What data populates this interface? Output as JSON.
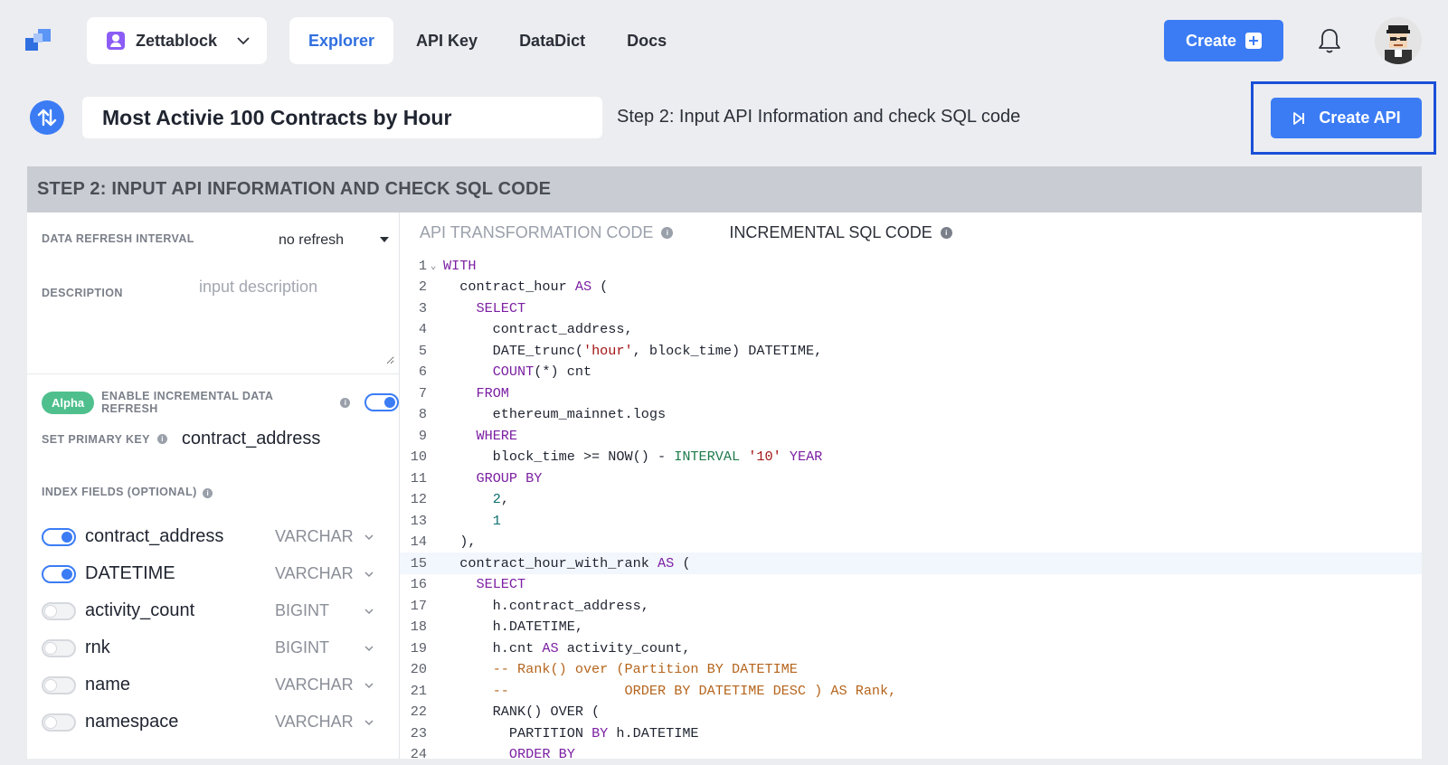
{
  "nav": {
    "workspace": "Zettablock",
    "tabs": [
      "Explorer",
      "API Key",
      "DataDict",
      "Docs"
    ],
    "create_label": "Create"
  },
  "page": {
    "title": "Most Activie 100 Contracts by Hour",
    "step_text": "Step 2: Input API Information and check SQL code",
    "create_api_label": "Create API",
    "panel_header": "STEP 2: INPUT API INFORMATION AND CHECK SQL CODE"
  },
  "form": {
    "refresh_label": "DATA REFRESH INTERVAL",
    "refresh_value": "no refresh",
    "description_label": "DESCRIPTION",
    "description_placeholder": "input description",
    "alpha_badge": "Alpha",
    "incremental_label": "ENABLE INCREMENTAL DATA REFRESH",
    "incremental_enabled": true,
    "primary_key_label": "SET PRIMARY KEY",
    "primary_key_value": "contract_address",
    "index_fields_label": "INDEX FIELDS (OPTIONAL)",
    "fields": [
      {
        "name": "contract_address",
        "type": "VARCHAR",
        "enabled": true
      },
      {
        "name": "DATETIME",
        "type": "VARCHAR",
        "enabled": true
      },
      {
        "name": "activity_count",
        "type": "BIGINT",
        "enabled": false
      },
      {
        "name": "rnk",
        "type": "BIGINT",
        "enabled": false
      },
      {
        "name": "name",
        "type": "VARCHAR",
        "enabled": false
      },
      {
        "name": "namespace",
        "type": "VARCHAR",
        "enabled": false
      }
    ]
  },
  "code": {
    "tabs": [
      "API TRANSFORMATION CODE",
      "INCREMENTAL SQL CODE"
    ],
    "active_tab": 1,
    "highlighted_line": 15,
    "lines": [
      [
        [
          "kw",
          "WITH"
        ]
      ],
      [
        [
          "t",
          "  contract_hour "
        ],
        [
          "kw",
          "AS"
        ],
        [
          "t",
          " ("
        ]
      ],
      [
        [
          "t",
          "    "
        ],
        [
          "kw",
          "SELECT"
        ]
      ],
      [
        [
          "t",
          "      contract_address,"
        ]
      ],
      [
        [
          "t",
          "      DATE_trunc("
        ],
        [
          "str",
          "'hour'"
        ],
        [
          "t",
          ", block_time) DATETIME,"
        ]
      ],
      [
        [
          "t",
          "      "
        ],
        [
          "kw",
          "COUNT"
        ],
        [
          "t",
          "(*) cnt"
        ]
      ],
      [
        [
          "t",
          "    "
        ],
        [
          "kw",
          "FROM"
        ]
      ],
      [
        [
          "t",
          "      ethereum_mainnet.logs"
        ]
      ],
      [
        [
          "t",
          "    "
        ],
        [
          "kw",
          "WHERE"
        ]
      ],
      [
        [
          "t",
          "      block_time >= NOW() - "
        ],
        [
          "intv",
          "INTERVAL"
        ],
        [
          "t",
          " "
        ],
        [
          "str",
          "'10'"
        ],
        [
          "t",
          " "
        ],
        [
          "kw",
          "YEAR"
        ]
      ],
      [
        [
          "t",
          "    "
        ],
        [
          "kw",
          "GROUP BY"
        ]
      ],
      [
        [
          "t",
          "      "
        ],
        [
          "num",
          "2"
        ],
        [
          "t",
          ","
        ]
      ],
      [
        [
          "t",
          "      "
        ],
        [
          "num",
          "1"
        ]
      ],
      [
        [
          "t",
          "  ),"
        ]
      ],
      [
        [
          "t",
          "  contract_hour_with_rank "
        ],
        [
          "kw",
          "AS"
        ],
        [
          "t",
          " ("
        ]
      ],
      [
        [
          "t",
          "    "
        ],
        [
          "kw",
          "SELECT"
        ]
      ],
      [
        [
          "t",
          "      h.contract_address,"
        ]
      ],
      [
        [
          "t",
          "      h.DATETIME,"
        ]
      ],
      [
        [
          "t",
          "      h.cnt "
        ],
        [
          "kw",
          "AS"
        ],
        [
          "t",
          " activity_count,"
        ]
      ],
      [
        [
          "t",
          "      "
        ],
        [
          "cmt",
          "-- Rank() over (Partition BY DATETIME"
        ]
      ],
      [
        [
          "t",
          "      "
        ],
        [
          "cmt",
          "--              ORDER BY DATETIME DESC ) AS Rank,"
        ]
      ],
      [
        [
          "t",
          "      RANK() OVER ("
        ]
      ],
      [
        [
          "t",
          "        PARTITION "
        ],
        [
          "kw",
          "BY"
        ],
        [
          "t",
          " h.DATETIME"
        ]
      ],
      [
        [
          "t",
          "        "
        ],
        [
          "kw",
          "ORDER BY"
        ]
      ]
    ]
  },
  "colors": {
    "accent": "#3b7cf5",
    "alpha_green": "#4fc08d",
    "highlight_border": "#1a4fd8"
  }
}
